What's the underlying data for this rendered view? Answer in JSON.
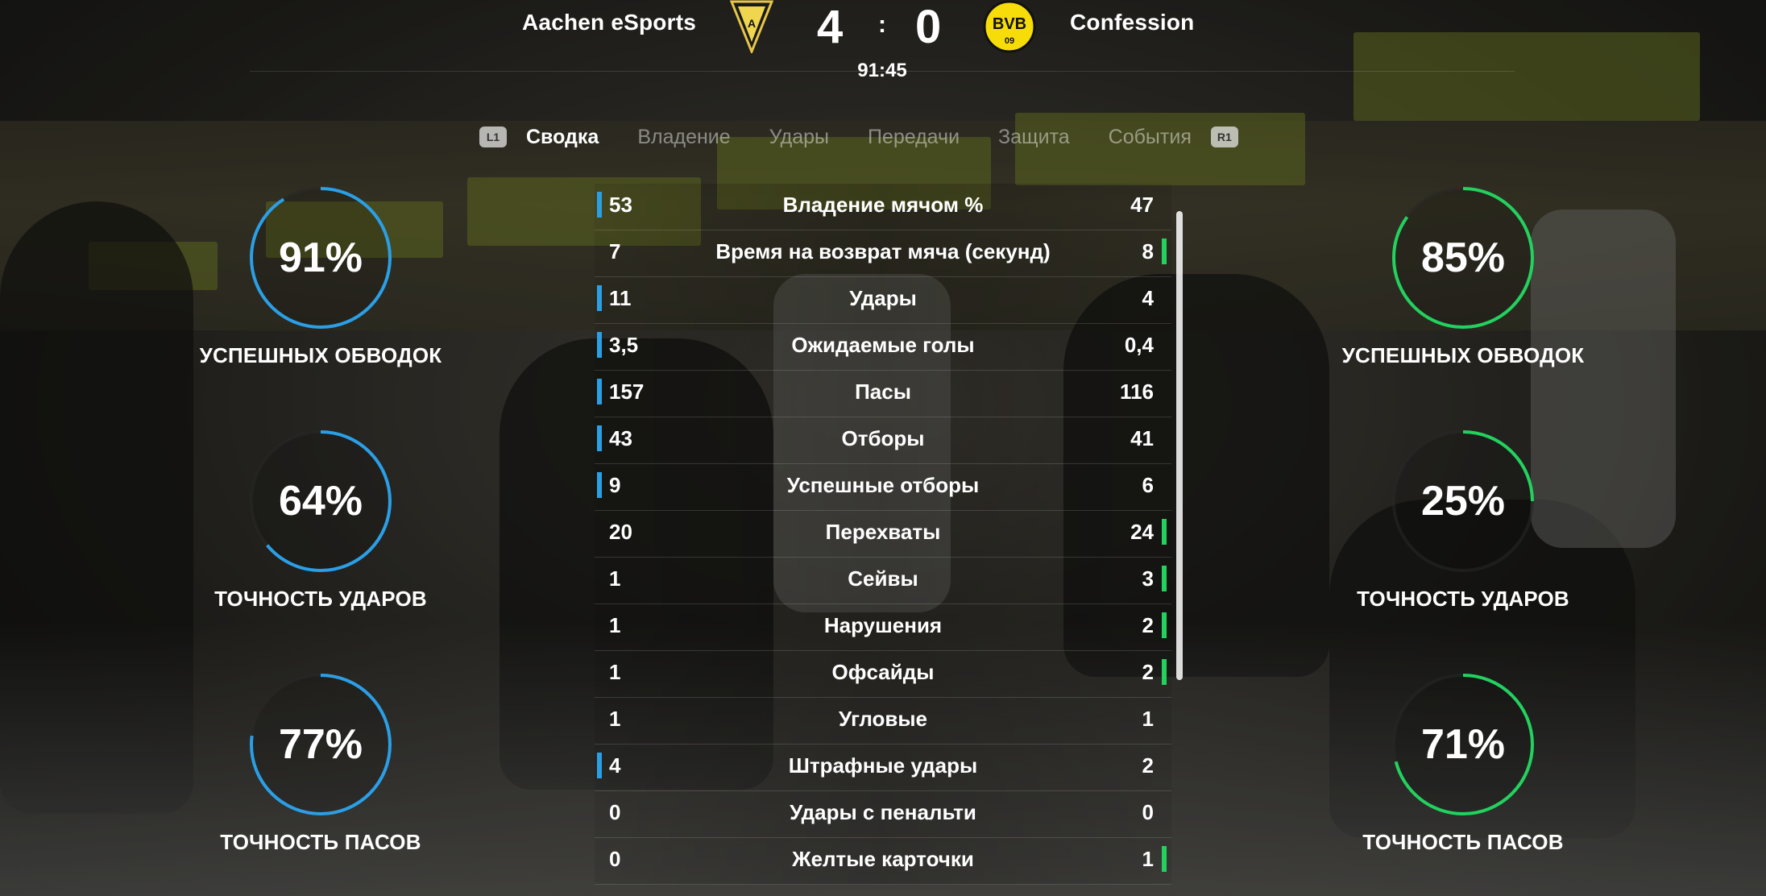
{
  "header": {
    "home_team": "Aachen eSports",
    "away_team": "Confession",
    "home_score": "4",
    "away_score": "0",
    "separator": ":",
    "clock": "91:45",
    "home_crest_icon": "alemannia-crest-icon",
    "away_crest_icon": "bvb-crest-icon",
    "away_crest_text": "BVB",
    "away_crest_year": "09"
  },
  "tabs": {
    "left_button": "L1",
    "right_button": "R1",
    "items": [
      {
        "label": "Сводка",
        "active": true
      },
      {
        "label": "Владение",
        "active": false
      },
      {
        "label": "Удары",
        "active": false
      },
      {
        "label": "Передачи",
        "active": false
      },
      {
        "label": "Защита",
        "active": false
      },
      {
        "label": "События",
        "active": false
      }
    ]
  },
  "colors": {
    "home_accent": "#2b9fe6",
    "away_accent": "#23d15e"
  },
  "stats": [
    {
      "label": "Владение мячом %",
      "home": "53",
      "away": "47",
      "lead": "home"
    },
    {
      "label": "Время на возврат мяча (секунд)",
      "home": "7",
      "away": "8",
      "lead": "away"
    },
    {
      "label": "Удары",
      "home": "11",
      "away": "4",
      "lead": "home"
    },
    {
      "label": "Ожидаемые голы",
      "home": "3,5",
      "away": "0,4",
      "lead": "home"
    },
    {
      "label": "Пасы",
      "home": "157",
      "away": "116",
      "lead": "home"
    },
    {
      "label": "Отборы",
      "home": "43",
      "away": "41",
      "lead": "home"
    },
    {
      "label": "Успешные отборы",
      "home": "9",
      "away": "6",
      "lead": "home"
    },
    {
      "label": "Перехваты",
      "home": "20",
      "away": "24",
      "lead": "away"
    },
    {
      "label": "Сейвы",
      "home": "1",
      "away": "3",
      "lead": "away"
    },
    {
      "label": "Нарушения",
      "home": "1",
      "away": "2",
      "lead": "away"
    },
    {
      "label": "Офсайды",
      "home": "1",
      "away": "2",
      "lead": "away"
    },
    {
      "label": "Угловые",
      "home": "1",
      "away": "1",
      "lead": "none"
    },
    {
      "label": "Штрафные удары",
      "home": "4",
      "away": "2",
      "lead": "home"
    },
    {
      "label": "Удары с пенальти",
      "home": "0",
      "away": "0",
      "lead": "none"
    },
    {
      "label": "Желтые карточки",
      "home": "0",
      "away": "1",
      "lead": "away"
    }
  ],
  "rings": {
    "home": [
      {
        "value": 91,
        "text": "91%",
        "caption": "УСПЕШНЫХ ОБВОДОК"
      },
      {
        "value": 64,
        "text": "64%",
        "caption": "ТОЧНОСТЬ УДАРОВ"
      },
      {
        "value": 77,
        "text": "77%",
        "caption": "ТОЧНОСТЬ ПАСОВ"
      }
    ],
    "away": [
      {
        "value": 85,
        "text": "85%",
        "caption": "УСПЕШНЫХ ОБВОДОК"
      },
      {
        "value": 25,
        "text": "25%",
        "caption": "ТОЧНОСТЬ УДАРОВ"
      },
      {
        "value": 71,
        "text": "71%",
        "caption": "ТОЧНОСТЬ ПАСОВ"
      }
    ]
  }
}
